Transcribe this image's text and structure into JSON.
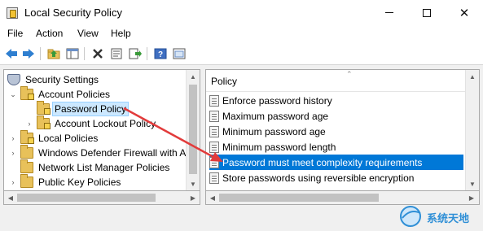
{
  "window": {
    "title": "Local Security Policy",
    "minimize_icon": "minimize-icon",
    "maximize_icon": "maximize-icon",
    "close_icon": "close-icon"
  },
  "menu": {
    "file": "File",
    "action": "Action",
    "view": "View",
    "help": "Help"
  },
  "toolbar": {
    "icons": [
      "back-arrow-icon",
      "forward-arrow-icon",
      "up-folder-icon",
      "show-hide-tree-icon",
      "delete-icon",
      "properties-icon",
      "export-list-icon",
      "help-icon",
      "console-icon"
    ]
  },
  "tree": {
    "root": "Security Settings",
    "account_policies": "Account Policies",
    "password_policy": "Password Policy",
    "account_lockout_policy": "Account Lockout Policy",
    "local_policies": "Local Policies",
    "windows_defender_firewall": "Windows Defender Firewall with A",
    "network_list_manager": "Network List Manager Policies",
    "public_key_policies": "Public Key Policies"
  },
  "list": {
    "column_header": "Policy",
    "items": [
      "Enforce password history",
      "Maximum password age",
      "Minimum password age",
      "Minimum password length",
      "Password must meet complexity requirements",
      "Store passwords using reversible encryption"
    ],
    "selected_index": 4
  },
  "watermark": {
    "text": "系统天地"
  },
  "colors": {
    "selection": "#0078d7",
    "annotation_arrow": "#e23b3b",
    "tree_selection": "#cce8ff"
  }
}
